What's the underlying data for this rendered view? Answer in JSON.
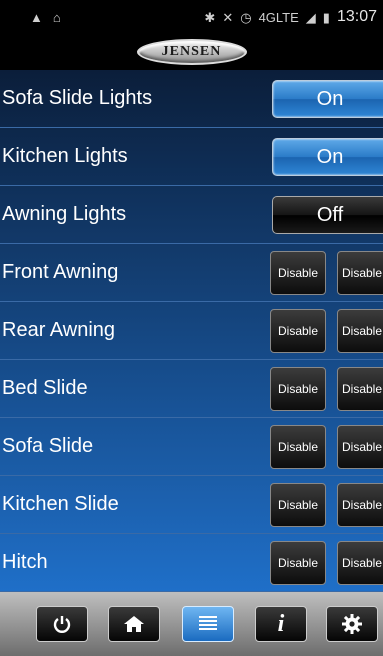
{
  "status_bar": {
    "network": "4GLTE",
    "time": "13:07",
    "icons": [
      "app-notification-icon",
      "tag-icon",
      "bluetooth-icon",
      "mute-icon",
      "alarm-icon",
      "signal-icon",
      "battery-icon"
    ]
  },
  "brand": {
    "logo_text": "JENSEN"
  },
  "rows": [
    {
      "label": "Sofa Slide Lights",
      "control": "toggle",
      "state": "On"
    },
    {
      "label": "Kitchen Lights",
      "control": "toggle",
      "state": "On"
    },
    {
      "label": "Awning Lights",
      "control": "toggle",
      "state": "Off"
    },
    {
      "label": "Front Awning",
      "control": "pair",
      "left": "Disable",
      "right": "Disable"
    },
    {
      "label": "Rear Awning",
      "control": "pair",
      "left": "Disable",
      "right": "Disable"
    },
    {
      "label": "Bed Slide",
      "control": "pair",
      "left": "Disable",
      "right": "Disable"
    },
    {
      "label": "Sofa Slide",
      "control": "pair",
      "left": "Disable",
      "right": "Disable"
    },
    {
      "label": "Kitchen Slide",
      "control": "pair",
      "left": "Disable",
      "right": "Disable"
    },
    {
      "label": "Hitch",
      "control": "pair",
      "left": "Disable",
      "right": "Disable"
    }
  ],
  "toolbar": {
    "buttons": [
      {
        "icon": "power-icon",
        "active": false
      },
      {
        "icon": "home-icon",
        "active": false
      },
      {
        "icon": "menu-list-icon",
        "active": true
      },
      {
        "icon": "info-icon",
        "active": false,
        "glyph": "i"
      },
      {
        "icon": "gear-icon",
        "active": false
      }
    ]
  },
  "colors": {
    "row_top": "#0b1e3a",
    "row_bottom": "#1f6fc8",
    "toggle_on": "#2f86d6",
    "toolbar_bg": "#9a9a9a"
  }
}
